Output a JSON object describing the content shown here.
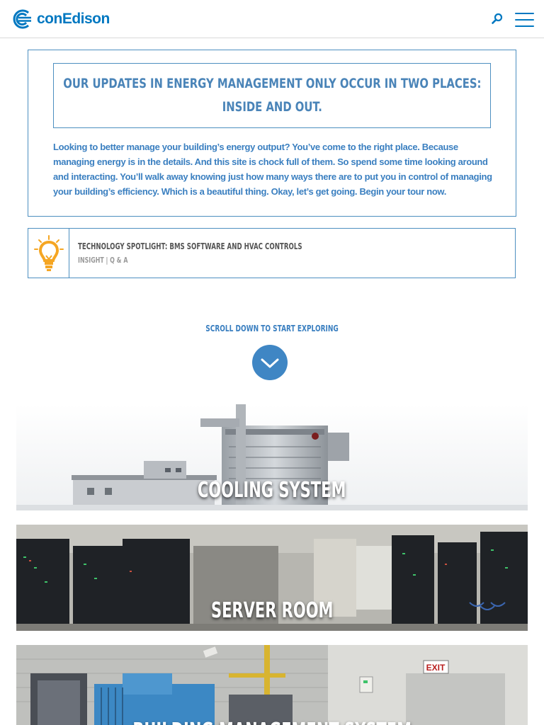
{
  "header": {
    "brand": "conEdison",
    "logo_icon": "con-edison-c-logo",
    "search_icon": "search-icon",
    "menu_icon": "hamburger-menu-icon"
  },
  "intro": {
    "headline_line1": "Our updates in energy management only occur in two places:",
    "headline_line2": "inside and out.",
    "body": "Looking to better manage your building’s energy output? You’ve come to the right place. Because managing energy is in the details. And this site is chock full of them. So spend some time looking around and interacting. You’ll walk away knowing just how many ways there are to put you in control of managing your building’s efficiency. Which is a beautiful thing. Okay, let’s get going. Begin your tour now."
  },
  "spotlight": {
    "icon": "lightbulb-icon",
    "title": "Technology Spotlight: BMS Software and HVAC Controls",
    "meta": "Insight | Q & A"
  },
  "scroll": {
    "label": "Scroll down to start exploring",
    "icon": "chevron-down-icon"
  },
  "tiles": [
    {
      "label": "Cooling System"
    },
    {
      "label": "Server Room"
    },
    {
      "label": "Building Management System"
    }
  ],
  "colors": {
    "brand_blue": "#0078c1",
    "accent_blue": "#3f86c4",
    "bulb_yellow": "#f5a623"
  }
}
